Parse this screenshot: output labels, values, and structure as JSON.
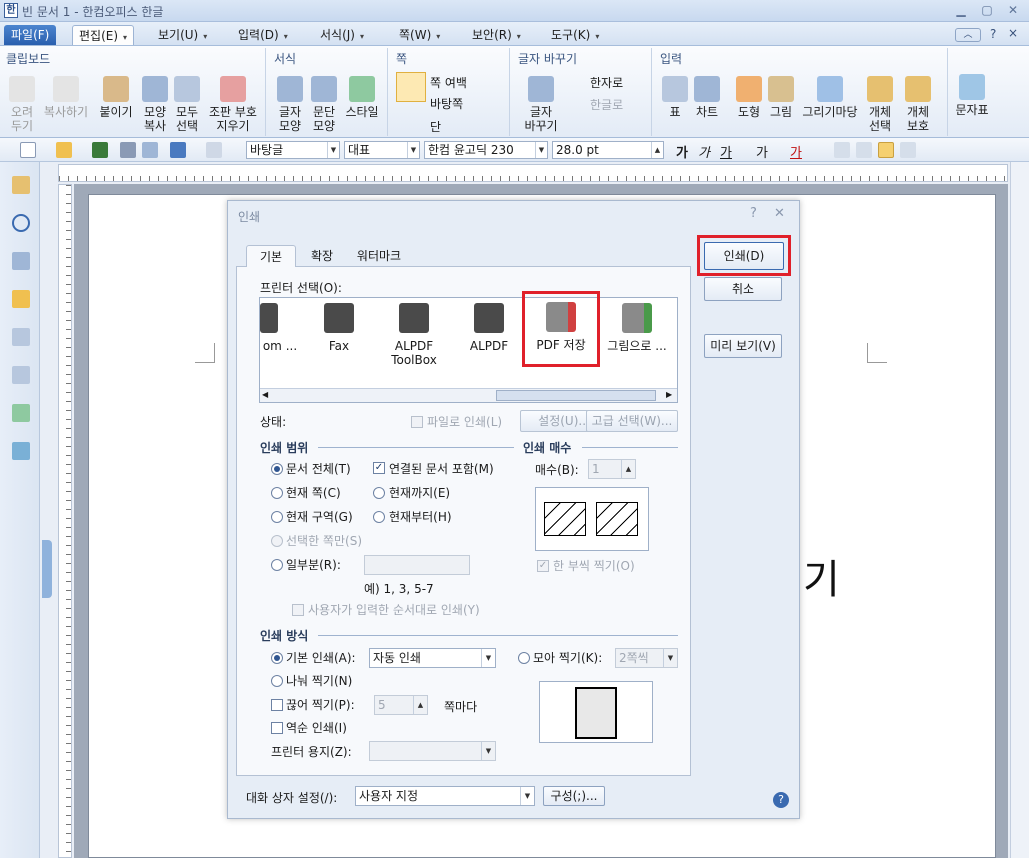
{
  "window": {
    "title": "빈 문서 1 - 한컴오피스 한글",
    "app_icon": "hwp-icon"
  },
  "menubar": {
    "items": [
      {
        "label": "파일(F)"
      },
      {
        "label": "편집(E)"
      },
      {
        "label": "보기(U)"
      },
      {
        "label": "입력(D)"
      },
      {
        "label": "서식(J)"
      },
      {
        "label": "쪽(W)"
      },
      {
        "label": "보안(R)"
      },
      {
        "label": "도구(K)"
      }
    ],
    "help": "?"
  },
  "ribbon": {
    "clipboard": {
      "title": "클립보드",
      "cut": "오려\n두기",
      "copy": "복사하기",
      "paste": "붙이기",
      "copy_format": "모양\n복사",
      "select_all": "모두\n선택",
      "style_rm": "조판 부호\n지우기"
    },
    "format": {
      "title": "서식",
      "char": "글자\n모양",
      "para": "문단\n모양",
      "style": "스타일"
    },
    "page": {
      "title": "쪽",
      "margin": "쪽 여백",
      "bg": "바탕쪽",
      "col": "단"
    },
    "convert": {
      "title": "글자 바꾸기",
      "change": "글자\n바꾸기",
      "hanja": "한자로",
      "hangul": "한글로"
    },
    "input": {
      "title": "입력",
      "table": "표",
      "chart": "차트",
      "shape": "도형",
      "image": "그림",
      "draw": "그리기마당",
      "obj_sel": "개체\n선택",
      "obj_prot": "개체\n보호",
      "symbol": "문자표"
    }
  },
  "toolbar": {
    "style": "바탕글",
    "lang": "대표",
    "font": "한컴 윤고딕 230",
    "size": "28.0",
    "unit": "pt"
  },
  "doc_text": "기",
  "dialog": {
    "title": "인쇄",
    "tabs": [
      "기본",
      "확장",
      "워터마크"
    ],
    "printer_label": "프린터 선택(O):",
    "printers": [
      {
        "name": "om ..."
      },
      {
        "name": "Fax"
      },
      {
        "name": "ALPDF\nToolBox"
      },
      {
        "name": "ALPDF"
      },
      {
        "name": "PDF 저장"
      },
      {
        "name": "그림으로 ..."
      }
    ],
    "status_label": "상태:",
    "print_to_file": "파일로 인쇄(L)",
    "settings_btn": "설정(U)...",
    "advanced_btn": "고급 선택(W)...",
    "range": {
      "title": "인쇄 범위",
      "all": "문서 전체(T)",
      "linked": "연결된 문서 포함(M)",
      "current_page": "현재 쪽(C)",
      "until_current": "현재까지(E)",
      "current_section": "현재 구역(G)",
      "from_current": "현재부터(H)",
      "selected": "선택한 쪽만(S)",
      "partial": "일부분(R):",
      "example": "예) 1, 3, 5-7",
      "user_order": "사용자가 입력한 순서대로 인쇄(Y)"
    },
    "copies": {
      "title": "인쇄 매수",
      "label": "매수(B):",
      "value": "1",
      "collate": "한 부씩 찍기(O)"
    },
    "method": {
      "title": "인쇄 방식",
      "basic": "기본 인쇄(A):",
      "basic_value": "자동 인쇄",
      "gather": "모아 찍기(K):",
      "gather_value": "2쪽씩",
      "split": "나눠 찍기(N)",
      "break": "끊어 찍기(P):",
      "break_value": "5",
      "per_page": "쪽마다",
      "reverse": "역순 인쇄(I)",
      "paper": "프린터 용지(Z):"
    },
    "buttons": {
      "print": "인쇄(D)",
      "cancel": "취소",
      "preview": "미리 보기(V)"
    },
    "footer": {
      "label": "대화 상자 설정(/):",
      "value": "사용자 지정",
      "config": "구성(;)..."
    }
  },
  "colors": {
    "accent": "#2a5fae",
    "highlight": "#e0202a"
  }
}
